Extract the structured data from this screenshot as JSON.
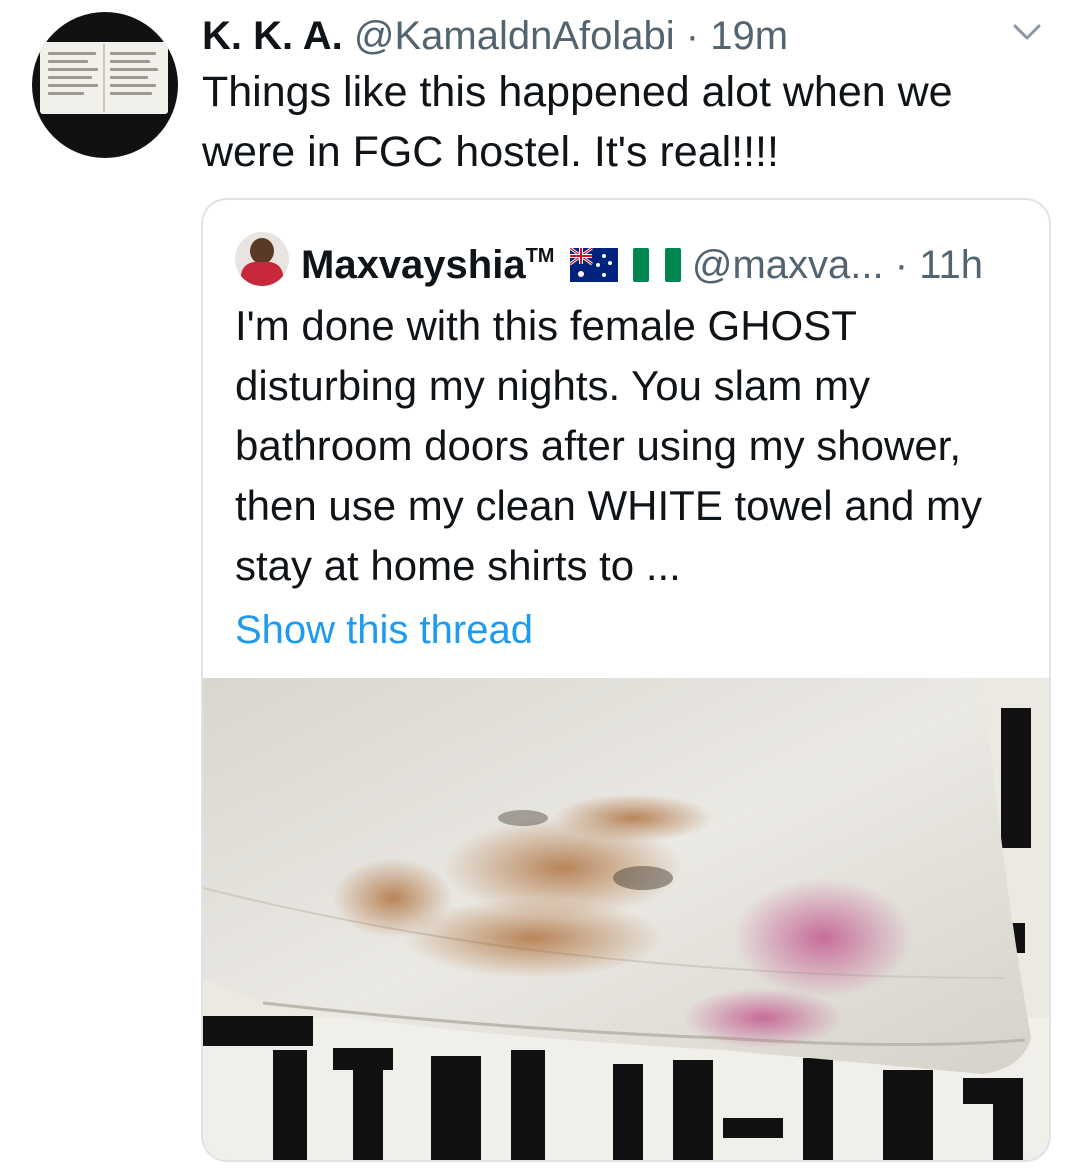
{
  "tweet": {
    "author_name": "K. K. A.",
    "author_handle": "@KamaldnAfolabi",
    "separator": "·",
    "time": "19m",
    "text": "Things like this happened alot when we were in FGC hostel. It's real!!!!",
    "avatar_icon": "open-book-avatar",
    "menu_icon": "chevron-down-icon"
  },
  "quoted_tweet": {
    "author_name": "Maxvayshia",
    "trademark": "TM",
    "flags": [
      "australia-flag",
      "nigeria-flag"
    ],
    "author_handle": "@maxva...",
    "separator": "·",
    "time": "11h",
    "text": "I'm done with this female GHOST disturbing my nights. You slam my bathroom doors after using my shower, then use my clean WHITE towel and my stay at home shirts to ...",
    "show_thread_label": "Show this thread",
    "link_color": "#1d9bf0",
    "photo": "stained-white-shirt-photo"
  }
}
